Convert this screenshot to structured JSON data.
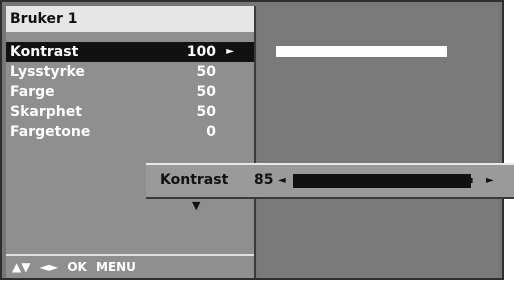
{
  "menu": {
    "title": "Bruker 1",
    "items": [
      {
        "label": "Kontrast",
        "value": "100",
        "arrow": "►"
      },
      {
        "label": "Lysstyrke",
        "value": "50"
      },
      {
        "label": "Farge",
        "value": "50"
      },
      {
        "label": "Skarphet",
        "value": "50"
      },
      {
        "label": "Fargetone",
        "value": "0"
      }
    ],
    "down_arrow": "▼",
    "nav": {
      "updown": "▲▼",
      "leftright": "◄►",
      "ok": "OK",
      "menu": "MENU"
    }
  },
  "slider": {
    "label": "Kontrast",
    "value": "85",
    "left_arrow": "◄",
    "right_arrow": "►",
    "ticks": "ıııı",
    "level_fraction": 0.85
  }
}
